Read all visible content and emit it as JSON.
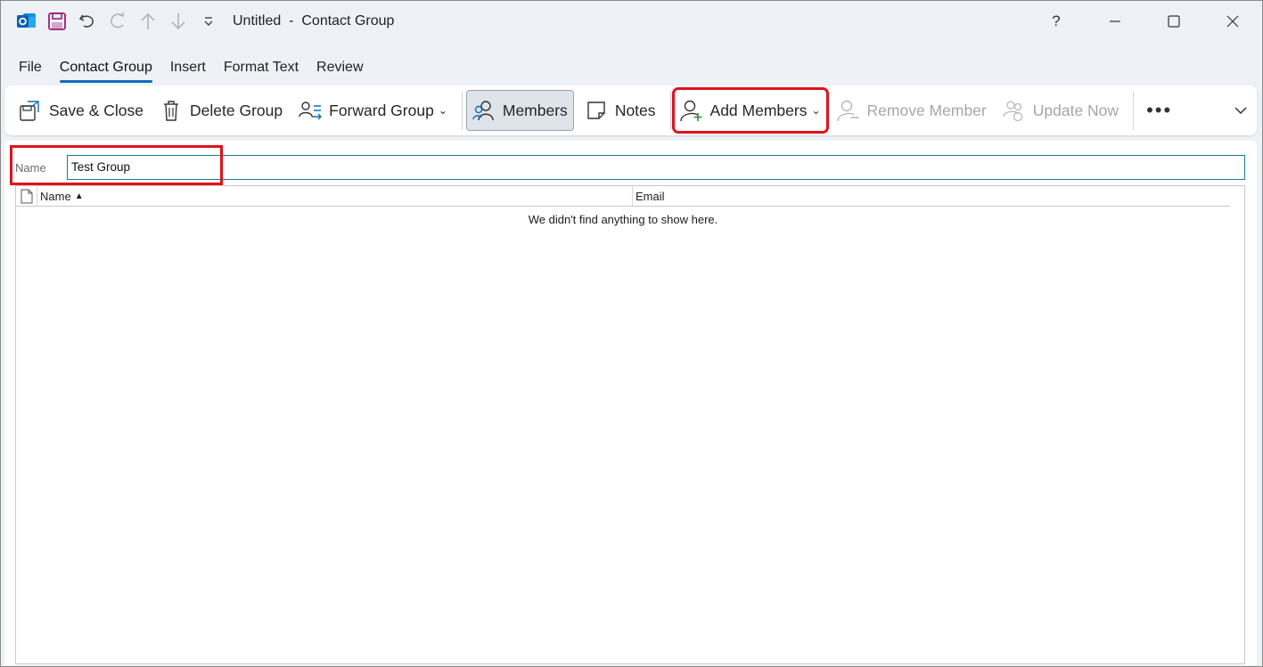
{
  "window": {
    "title": "Untitled  -  Contact Group",
    "help": "?"
  },
  "tabs": [
    {
      "label": "File"
    },
    {
      "label": "Contact Group"
    },
    {
      "label": "Insert"
    },
    {
      "label": "Format Text"
    },
    {
      "label": "Review"
    }
  ],
  "ribbon": {
    "save_close": "Save & Close",
    "delete_group": "Delete Group",
    "forward_group": "Forward Group",
    "members": "Members",
    "notes": "Notes",
    "add_members": "Add Members",
    "remove_member": "Remove Member",
    "update_now": "Update Now",
    "more": "•••"
  },
  "form": {
    "name_label": "Name",
    "name_value": "Test Group"
  },
  "list": {
    "col_name": "Name",
    "col_email": "Email",
    "empty_message": "We didn't find anything to show here."
  },
  "colors": {
    "accent": "#0f6cbd",
    "highlight": "#e0121b"
  }
}
